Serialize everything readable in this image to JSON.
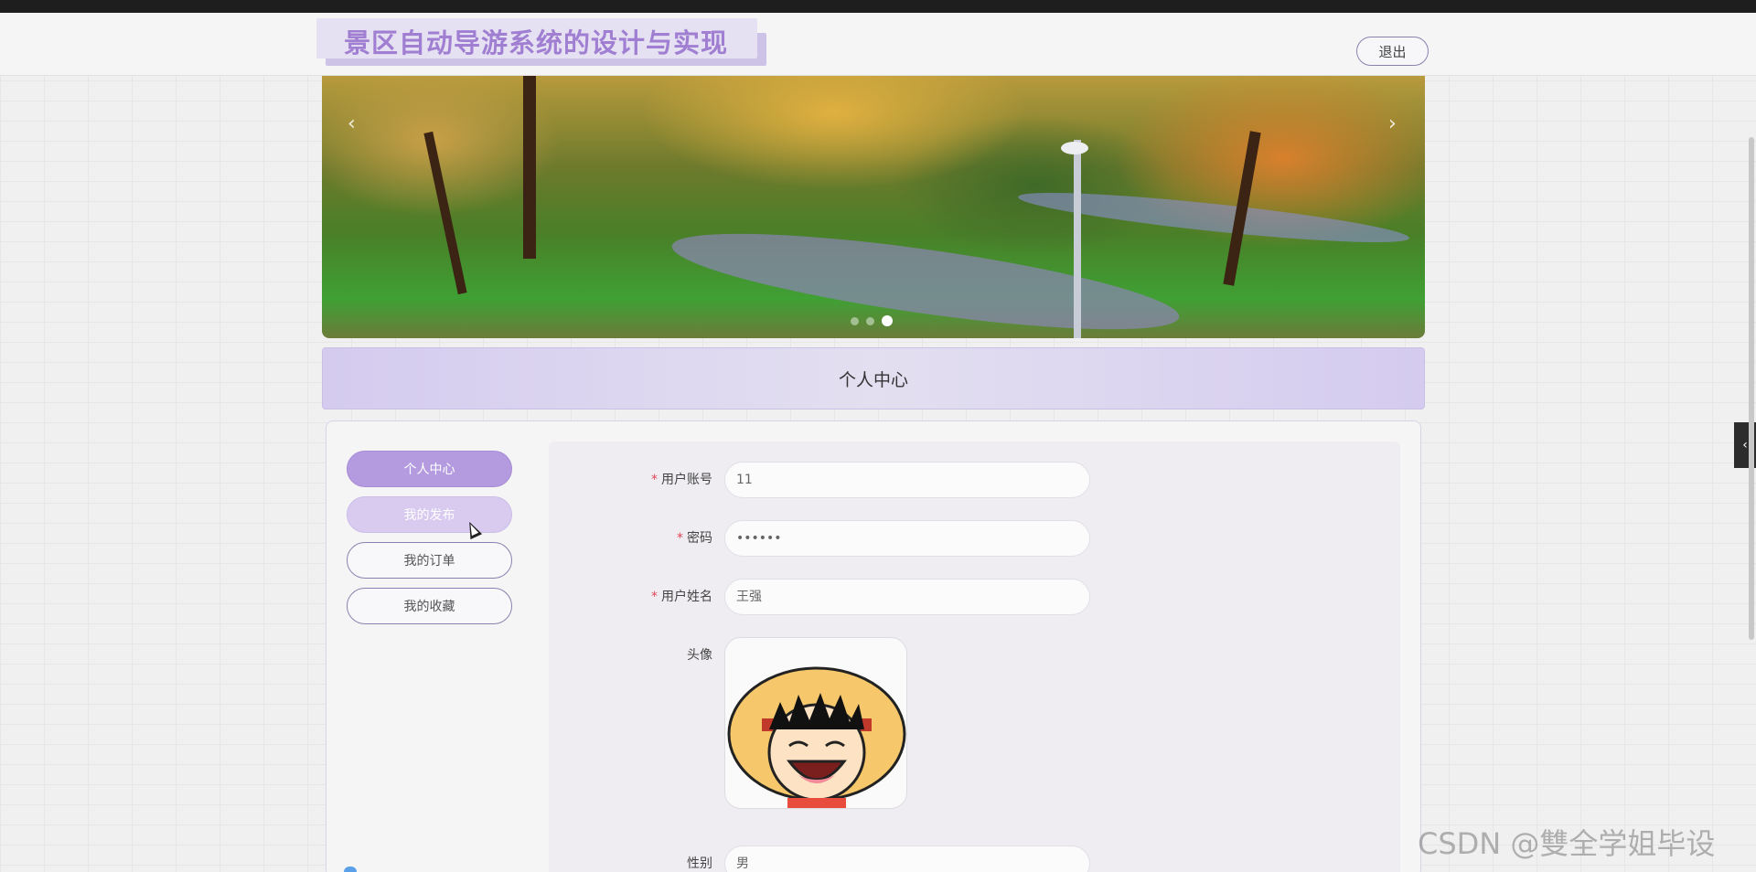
{
  "header": {
    "site_title": "景区自动导游系统的设计与实现",
    "logout_label": "退出"
  },
  "banner": {
    "prev_arrow": "‹",
    "next_arrow": "›",
    "slide_count": 3,
    "active_slide_index": 2
  },
  "section": {
    "title": "个人中心"
  },
  "sidebar": {
    "items": [
      {
        "label": "个人中心",
        "state": "active"
      },
      {
        "label": "我的发布",
        "state": "hover"
      },
      {
        "label": "我的订单",
        "state": "normal"
      },
      {
        "label": "我的收藏",
        "state": "normal"
      }
    ]
  },
  "form": {
    "account": {
      "label": "用户账号",
      "required": "*",
      "value": "11"
    },
    "password": {
      "label": "密码",
      "required": "*",
      "value": "••••••"
    },
    "name": {
      "label": "用户姓名",
      "required": "*",
      "value": "王强"
    },
    "avatar": {
      "label": "头像"
    },
    "gender": {
      "label": "性别",
      "value": "男",
      "arrow": "⌵"
    }
  },
  "side_tab": {
    "icon": "‹"
  },
  "watermark": "CSDN @雙全学姐毕设",
  "colors": {
    "accent": "#b49be0",
    "title_text": "#a07fd2",
    "required": "#e0455a",
    "section_bar": "#d4cbef"
  }
}
